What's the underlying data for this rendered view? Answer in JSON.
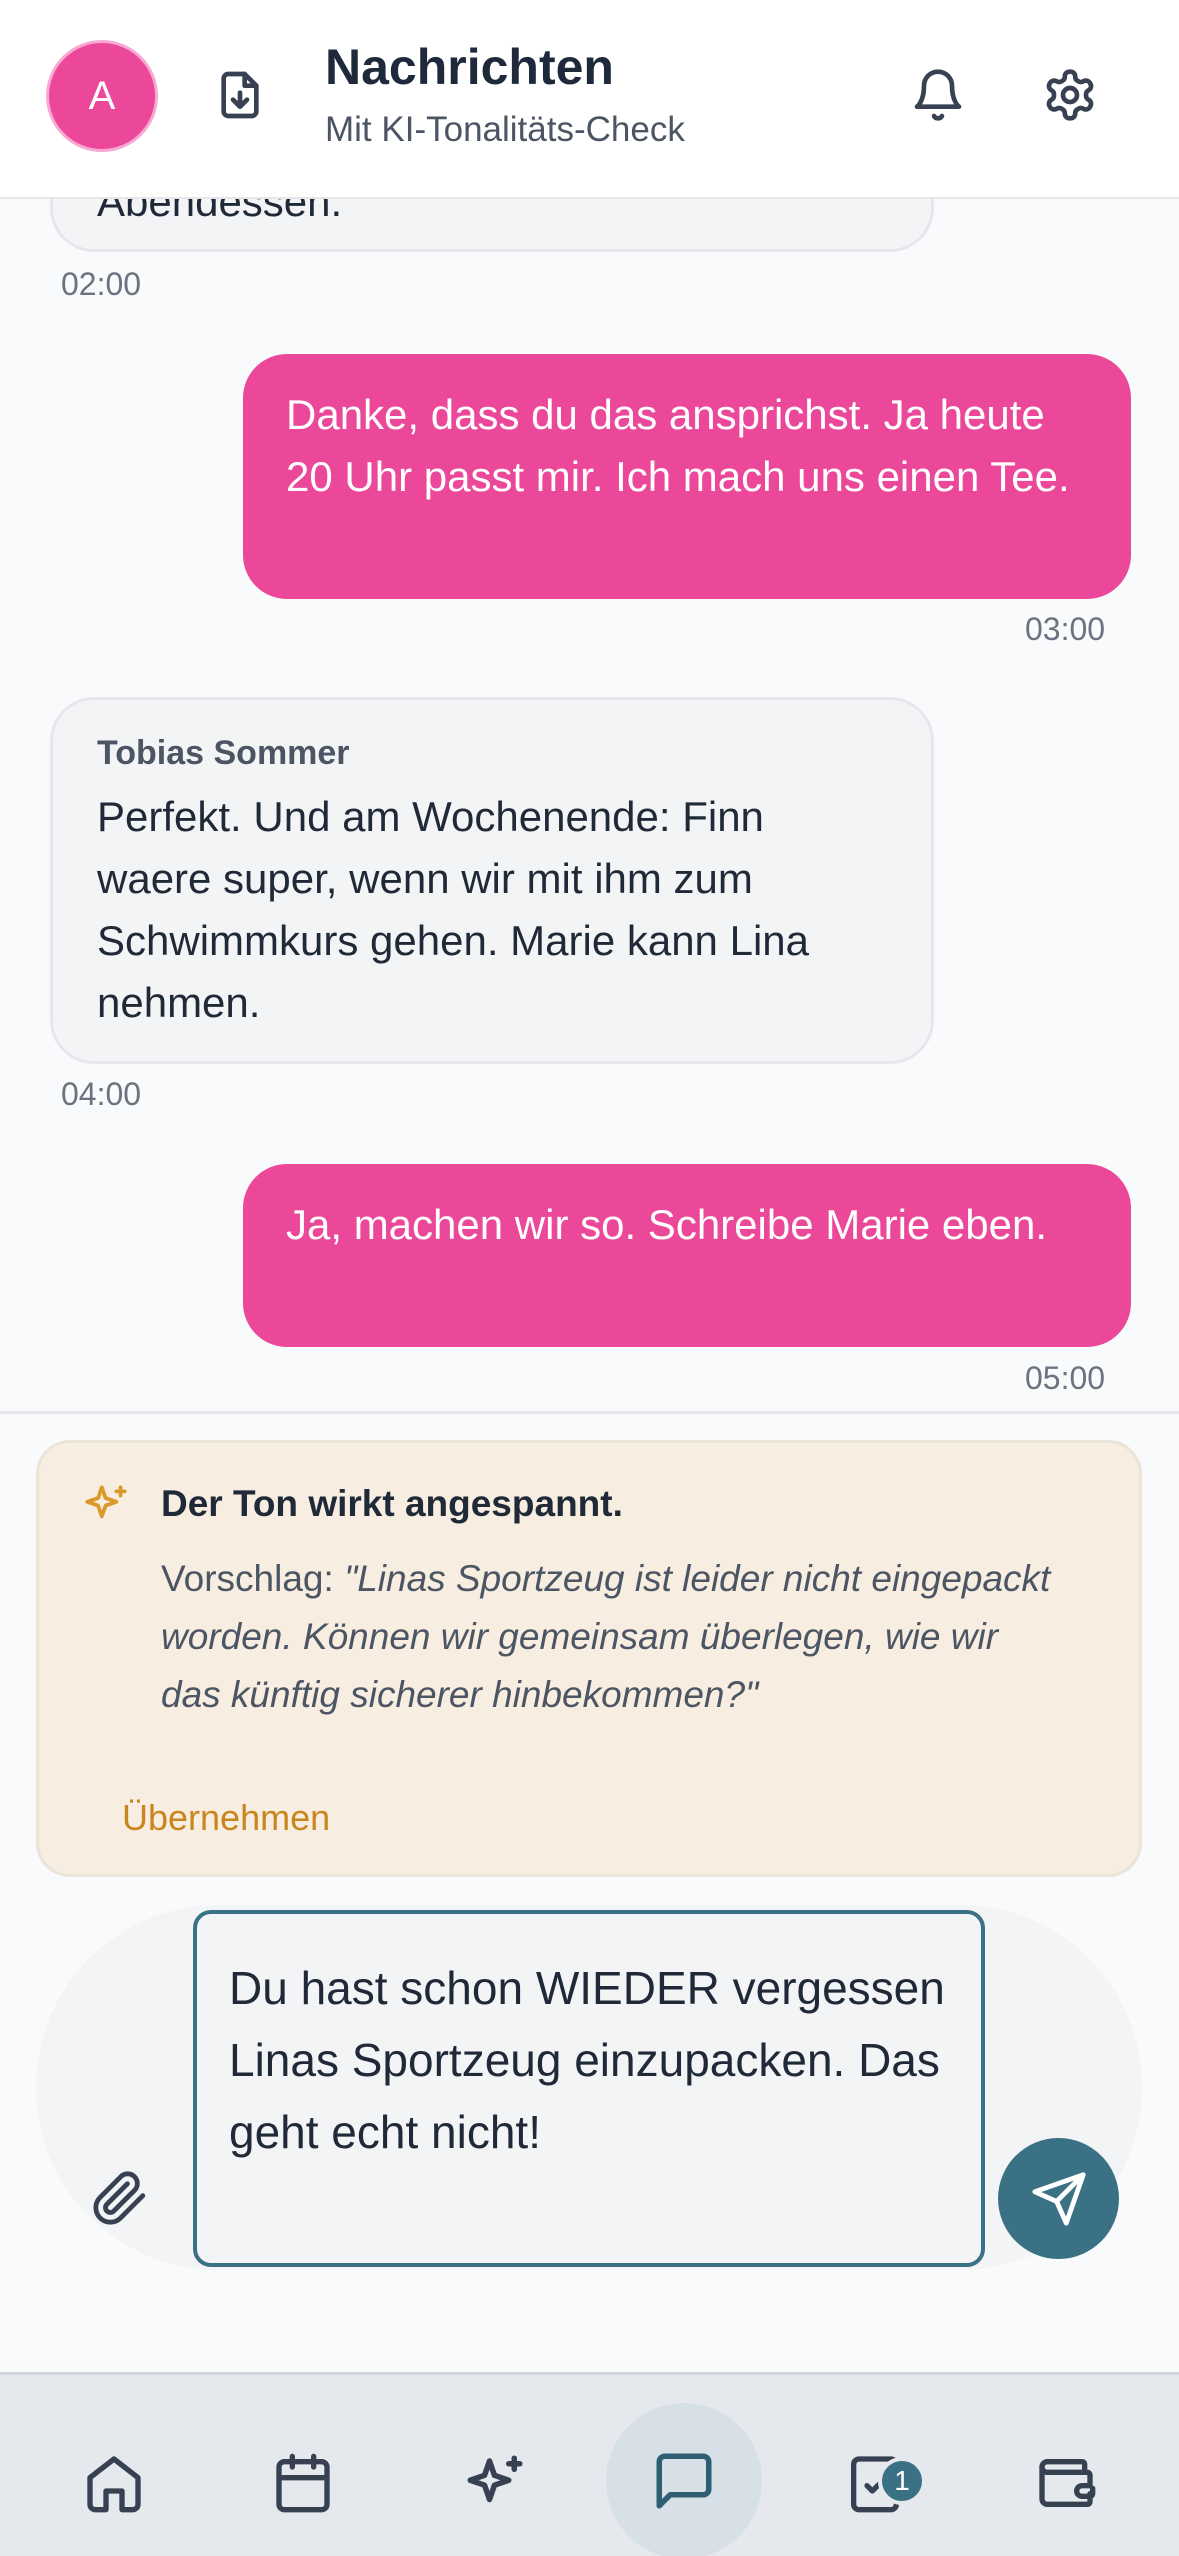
{
  "header": {
    "avatar_letter": "A",
    "title": "Nachrichten",
    "subtitle": "Mit KI-Tonalitäts-Check"
  },
  "messages": [
    {
      "direction": "in",
      "sender": "",
      "text": "Abendessen.",
      "time": "02:00"
    },
    {
      "direction": "out",
      "text": "Danke, dass du das ansprichst. Ja heute 20 Uhr passt mir. Ich mach uns einen Tee.",
      "time": "03:00"
    },
    {
      "direction": "in",
      "sender": "Tobias Sommer",
      "text": "Perfekt. Und am Wochenende: Finn waere super, wenn wir mit ihm zum Schwimmkurs gehen. Marie kann Lina nehmen.",
      "time": "04:00"
    },
    {
      "direction": "out",
      "text": "Ja, machen wir so. Schreibe Marie eben.",
      "time": "05:00"
    }
  ],
  "ai_check": {
    "title": "Der Ton wirkt angespannt.",
    "suggestion_prefix": "Vorschlag: ",
    "suggestion_text": "\"Linas Sportzeug ist leider nicht eingepackt worden. Können wir gemeinsam überlegen, wie wir das künftig sicherer hinbekommen?\"",
    "apply_label": "Übernehmen",
    "accent_color": "#c9851e"
  },
  "composer": {
    "value": "Du hast schon WIEDER vergessen Linas Sportzeug einzupacken. Das geht echt nicht!"
  },
  "nav": {
    "items": [
      "home-icon",
      "calendar-icon",
      "sparkles-icon",
      "chat-icon",
      "tasks-icon",
      "wallet-icon"
    ],
    "active": "chat-icon",
    "tasks_badge": "1"
  },
  "colors": {
    "brand_pink": "#ec4899",
    "primary_teal": "#3b7185"
  }
}
